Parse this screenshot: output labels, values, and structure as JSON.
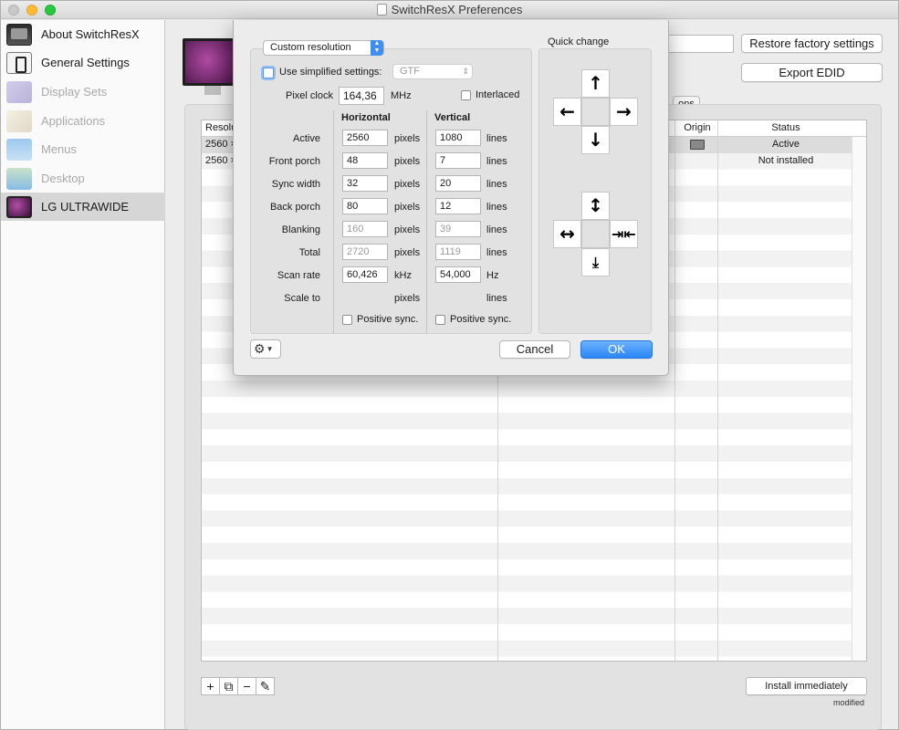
{
  "window": {
    "title": "SwitchResX Preferences"
  },
  "sidebar": {
    "items": [
      {
        "label": "About SwitchResX",
        "icon": "about-icon",
        "enabled": true
      },
      {
        "label": "General Settings",
        "icon": "settings-icon",
        "enabled": true
      },
      {
        "label": "Display Sets",
        "icon": "display-sets-icon",
        "enabled": false
      },
      {
        "label": "Applications",
        "icon": "applications-icon",
        "enabled": false
      },
      {
        "label": "Menus",
        "icon": "menus-icon",
        "enabled": false
      },
      {
        "label": "Desktop",
        "icon": "desktop-icon",
        "enabled": false
      },
      {
        "label": "LG ULTRAWIDE",
        "icon": "display-icon",
        "enabled": true,
        "selected": true
      }
    ]
  },
  "main": {
    "restore_label": "Restore factory settings",
    "export_label": "Export EDID",
    "tab_partial": "ons",
    "table": {
      "columns": [
        "Resolu",
        "Origin",
        "Status"
      ],
      "rows": [
        {
          "resolution": "2560 ×",
          "status": "Active"
        },
        {
          "resolution": "2560 ×",
          "status": "Not installed"
        }
      ]
    },
    "toolbar": {
      "add": "+",
      "duplicate": "⧉",
      "remove": "−",
      "edit": "✎"
    },
    "install_label": "Install immediately",
    "modified_label": "modified"
  },
  "sheet": {
    "mode_popup": "Custom resolution",
    "simplified_label": "Use simplified settings:",
    "simplified_popup": "GTF",
    "pixel_clock_label": "Pixel clock",
    "pixel_clock_value": "164,36",
    "pixel_clock_unit": "MHz",
    "interlaced_label": "Interlaced",
    "horizontal_header": "Horizontal",
    "vertical_header": "Vertical",
    "h_unit": "pixels",
    "v_unit": "lines",
    "rows": [
      {
        "label": "Active",
        "h": "2560",
        "v": "1080",
        "h_unit": "pixels",
        "v_unit": "lines"
      },
      {
        "label": "Front porch",
        "h": "48",
        "v": "7",
        "h_unit": "pixels",
        "v_unit": "lines"
      },
      {
        "label": "Sync width",
        "h": "32",
        "v": "20",
        "h_unit": "pixels",
        "v_unit": "lines"
      },
      {
        "label": "Back porch",
        "h": "80",
        "v": "12",
        "h_unit": "pixels",
        "v_unit": "lines"
      },
      {
        "label": "Blanking",
        "h": "160",
        "v": "39",
        "h_unit": "pixels",
        "v_unit": "lines"
      },
      {
        "label": "Total",
        "h": "2720",
        "v": "1119",
        "h_unit": "pixels",
        "v_unit": "lines"
      },
      {
        "label": "Scan rate",
        "h": "60,426",
        "v": "54,000",
        "h_unit": "kHz",
        "v_unit": "Hz"
      },
      {
        "label": "Scale to",
        "h": "",
        "v": "",
        "h_unit": "pixels",
        "v_unit": "lines"
      }
    ],
    "h_positive_sync": "Positive sync.",
    "v_positive_sync": "Positive sync.",
    "quick_change_label": "Quick change",
    "cancel_label": "Cancel",
    "ok_label": "OK",
    "arrows": {
      "up": "🡱",
      "left": "🡰",
      "right": "🡲",
      "down": "🡳"
    }
  }
}
